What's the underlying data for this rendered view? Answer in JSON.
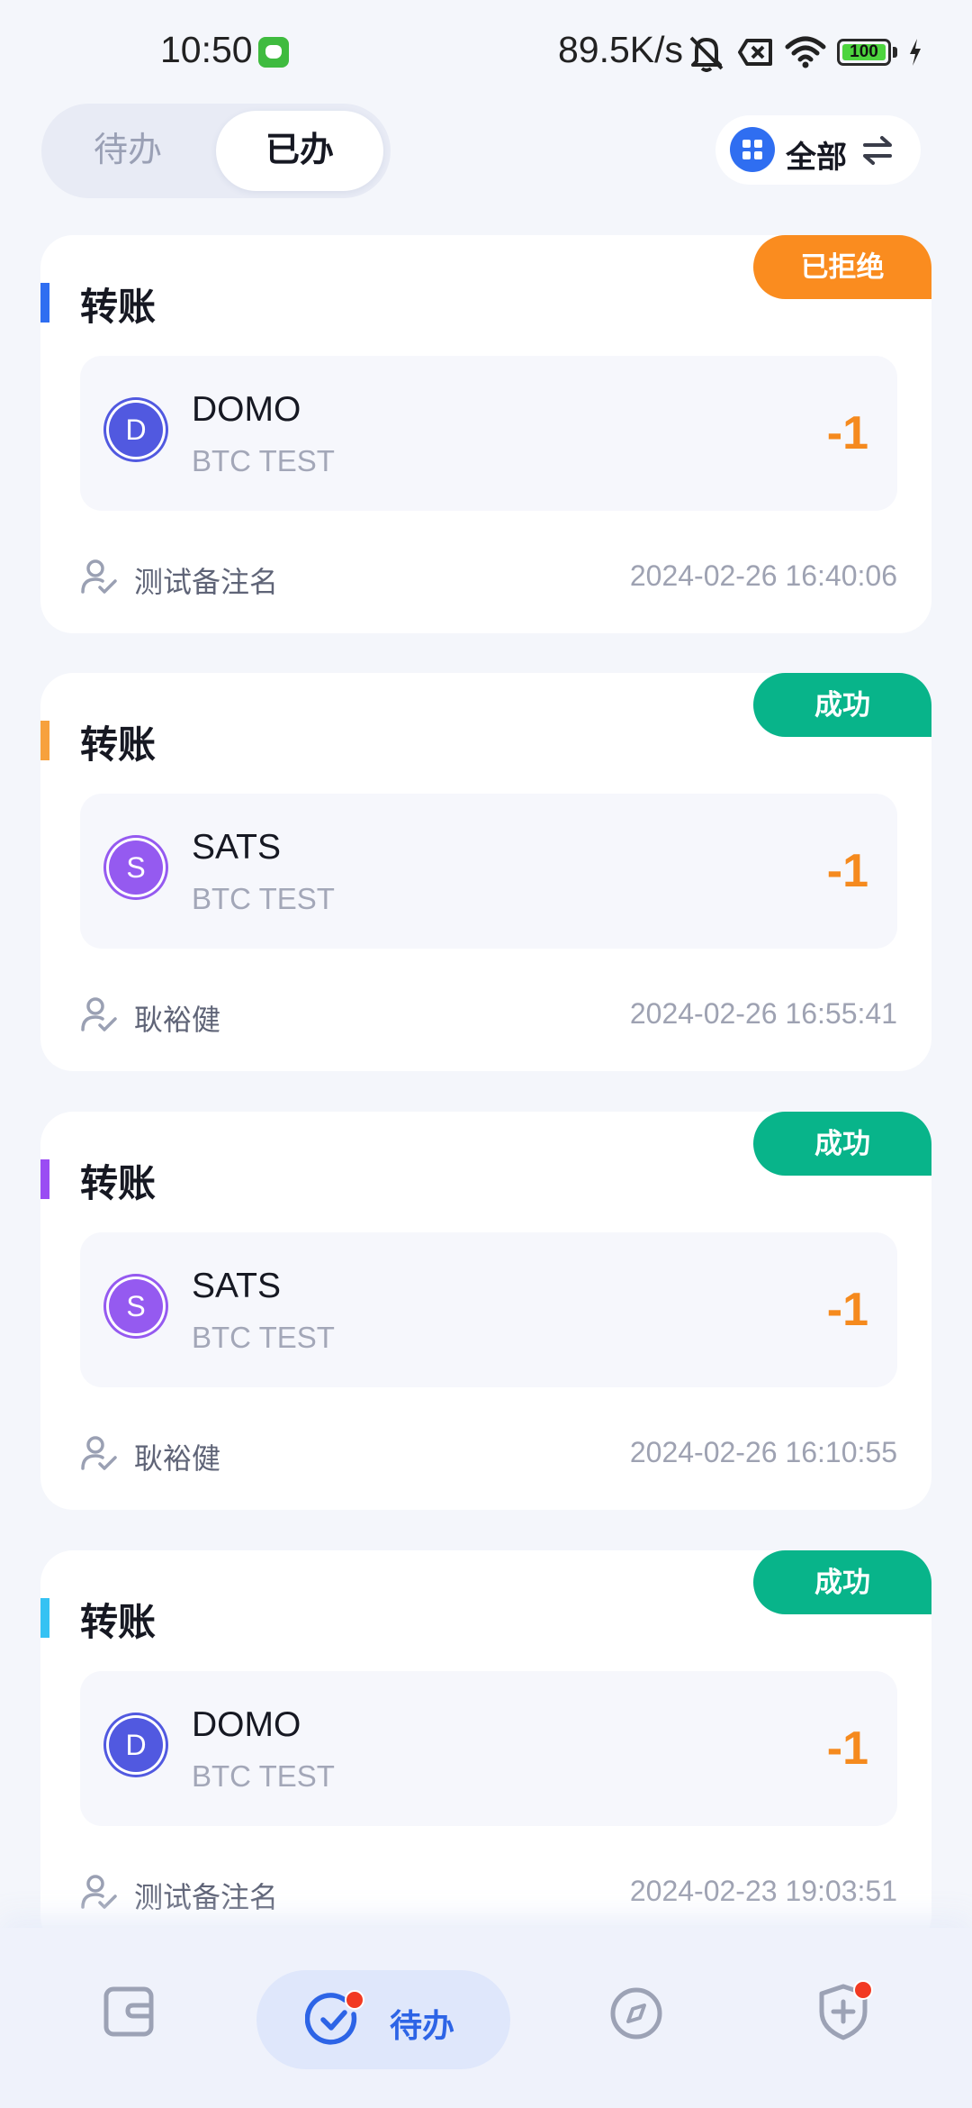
{
  "status_bar": {
    "time": "10:50",
    "net_speed": "89.5K/s",
    "battery": "100",
    "icons": [
      "app-notification-icon",
      "bell-muted-icon",
      "close-box-icon",
      "wifi-icon",
      "battery-icon",
      "charging-icon"
    ]
  },
  "tabs": {
    "pending": "待办",
    "done": "已办",
    "active": "已办"
  },
  "filter": {
    "label": "全部",
    "icon": "grid-icon",
    "swap_icon": "swap-icon"
  },
  "cards": [
    {
      "title": "转账",
      "accent_color": "#2f6ef1",
      "status": "已拒绝",
      "status_color": "#fa8c1f",
      "coin_letter": "D",
      "coin_color": "#5159e0",
      "asset": "DOMO",
      "network": "BTC TEST",
      "amount": "-1",
      "remark": "测试备注名",
      "time": "2024-02-26 16:40:06"
    },
    {
      "title": "转账",
      "accent_color": "#f7a13d",
      "status": "成功",
      "status_color": "#08b48a",
      "coin_letter": "S",
      "coin_color": "#955af0",
      "asset": "SATS",
      "network": "BTC TEST",
      "amount": "-1",
      "remark": "耿裕健",
      "time": "2024-02-26 16:55:41"
    },
    {
      "title": "转账",
      "accent_color": "#9a4cf3",
      "status": "成功",
      "status_color": "#08b48a",
      "coin_letter": "S",
      "coin_color": "#955af0",
      "asset": "SATS",
      "network": "BTC TEST",
      "amount": "-1",
      "remark": "耿裕健",
      "time": "2024-02-26 16:10:55"
    },
    {
      "title": "转账",
      "accent_color": "#35c2f3",
      "status": "成功",
      "status_color": "#08b48a",
      "coin_letter": "D",
      "coin_color": "#5159e0",
      "asset": "DOMO",
      "network": "BTC TEST",
      "amount": "-1",
      "remark": "测试备注名",
      "time": "2024-02-23 19:03:51"
    }
  ],
  "bottom_nav": {
    "items": [
      {
        "icon": "wallet-icon",
        "label": ""
      },
      {
        "icon": "todo-check-icon",
        "label": "待办",
        "active": true,
        "badge": true
      },
      {
        "icon": "compass-icon",
        "label": ""
      },
      {
        "icon": "shield-plus-icon",
        "label": "",
        "badge": true
      }
    ],
    "active_color": "#2d64e6"
  }
}
